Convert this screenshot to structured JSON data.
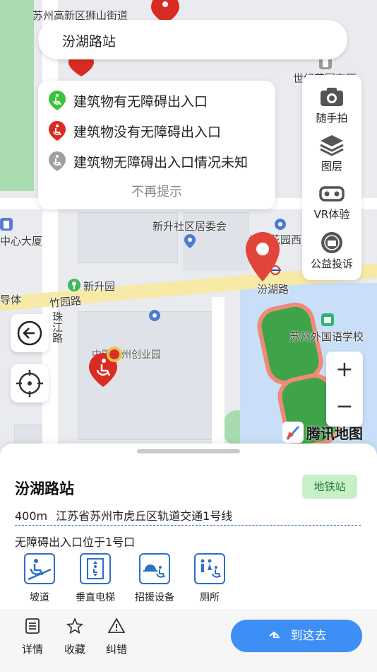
{
  "search": {
    "value": "汾湖路站"
  },
  "legend": {
    "items": [
      {
        "label": "建筑物有无障碍出入口",
        "color": "#3cc43c"
      },
      {
        "label": "建筑物没有无障碍出入口",
        "color": "#d92b22"
      },
      {
        "label": "建筑物无障碍出入口情况未知",
        "color": "#a0a0a0"
      }
    ],
    "dismiss": "不再提示"
  },
  "toolbar": {
    "items": [
      {
        "label": "随手拍",
        "icon": "camera-icon"
      },
      {
        "label": "图层",
        "icon": "layers-icon"
      },
      {
        "label": "VR体验",
        "icon": "vr-goggles-icon"
      },
      {
        "label": "公益投诉",
        "icon": "emblem-icon"
      }
    ]
  },
  "map": {
    "labels": {
      "district": "苏州高新区狮山街道",
      "world_garden": "世纪花园东区",
      "committee": "新升社区居委会",
      "garden_west": "世纪花园西区",
      "station": "汾湖路",
      "xinsheng": "新升园",
      "zhuyuan_road": "竹园路",
      "zhujiang_road": "珠江路",
      "center_building": "中心大厦",
      "guide": "导体",
      "foreign_school": "苏州外国语学校",
      "startup_park": "中国苏州创业园"
    },
    "logo": "腾讯地图",
    "zoom_in": "+",
    "zoom_out": "−"
  },
  "place": {
    "name": "汾湖路站",
    "type_tag": "地铁站",
    "distance": "400m",
    "address": "江苏省苏州市虎丘区轨道交通1号线",
    "accessible_note": "无障碍出入口位于1号口",
    "facilities": [
      {
        "label": "坡道",
        "icon": "ramp-icon"
      },
      {
        "label": "垂直电梯",
        "icon": "elevator-icon"
      },
      {
        "label": "招援设备",
        "icon": "call-bell-icon"
      },
      {
        "label": "厕所",
        "icon": "toilet-icon"
      }
    ]
  },
  "actions": {
    "details": "详情",
    "favorite": "收藏",
    "report": "纠错",
    "go": "到这去"
  },
  "colors": {
    "accent": "#3d8ef5",
    "pin_red": "#e2443a",
    "tag_bg": "#c7f0c9"
  }
}
